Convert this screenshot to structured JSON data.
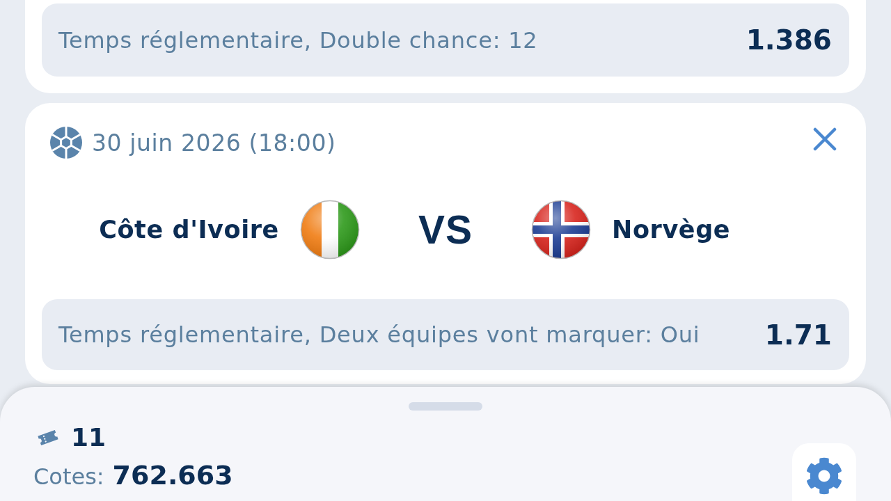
{
  "cards": [
    {
      "kind": "market_only",
      "market": "Temps réglementaire, Double chance: 12",
      "odds": "1.386"
    },
    {
      "kind": "match",
      "date": "30 juin 2026 (18:00)",
      "teams": [
        {
          "name": "Côte d'Ivoire"
        },
        {
          "name": "Norvège"
        }
      ],
      "vs": "VS",
      "market": "Temps réglementaire, Deux équipes vont marquer: Oui",
      "odds": "1.71"
    }
  ],
  "bet_slip": {
    "count": "11",
    "odds_label": "Cotes:",
    "odds_value": "762.663"
  }
}
